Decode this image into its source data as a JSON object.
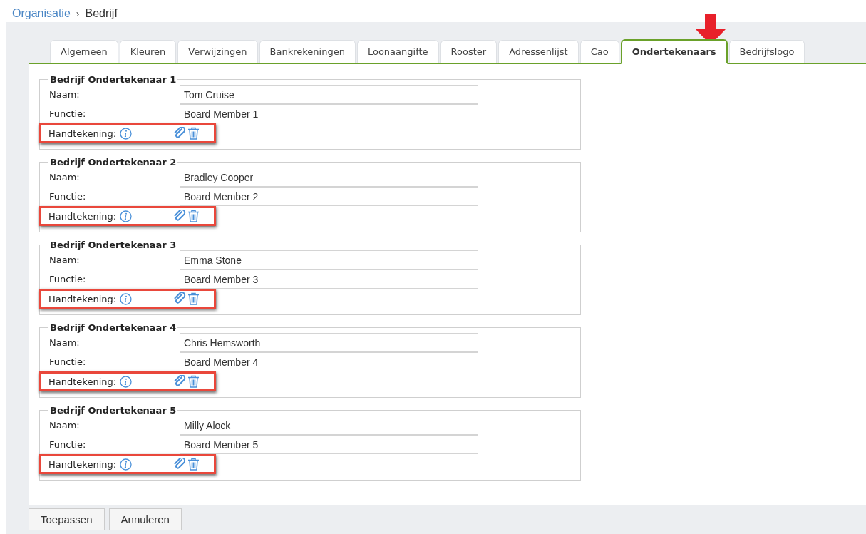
{
  "breadcrumb": {
    "parent": "Organisatie",
    "separator": "›",
    "current": "Bedrijf"
  },
  "tabs": [
    {
      "label": "Algemeen",
      "selected": false
    },
    {
      "label": "Kleuren",
      "selected": false
    },
    {
      "label": "Verwijzingen",
      "selected": false
    },
    {
      "label": "Bankrekeningen",
      "selected": false
    },
    {
      "label": "Loonaangifte",
      "selected": false
    },
    {
      "label": "Rooster",
      "selected": false
    },
    {
      "label": "Adressenlijst",
      "selected": false
    },
    {
      "label": "Cao",
      "selected": false
    },
    {
      "label": "Ondertekenaars",
      "selected": true
    },
    {
      "label": "Bedrijfslogo",
      "selected": false
    }
  ],
  "signers": [
    {
      "title": "Bedrijf Ondertekenaar 1",
      "name_label": "Naam:",
      "name": "Tom Cruise",
      "function_label": "Functie:",
      "function": "Board Member 1",
      "signature_label": "Handtekening:"
    },
    {
      "title": "Bedrijf Ondertekenaar 2",
      "name_label": "Naam:",
      "name": "Bradley Cooper",
      "function_label": "Functie:",
      "function": "Board Member 2",
      "signature_label": "Handtekening:"
    },
    {
      "title": "Bedrijf Ondertekenaar 3",
      "name_label": "Naam:",
      "name": "Emma Stone",
      "function_label": "Functie:",
      "function": "Board Member 3",
      "signature_label": "Handtekening:"
    },
    {
      "title": "Bedrijf Ondertekenaar 4",
      "name_label": "Naam:",
      "name": "Chris Hemsworth",
      "function_label": "Functie:",
      "function": "Board Member 4",
      "signature_label": "Handtekening:"
    },
    {
      "title": "Bedrijf Ondertekenaar 5",
      "name_label": "Naam:",
      "name": "Milly Alock",
      "function_label": "Functie:",
      "function": "Board Member 5",
      "signature_label": "Handtekening:"
    }
  ],
  "buttons": [
    "Toepassen",
    "Annuleren"
  ]
}
